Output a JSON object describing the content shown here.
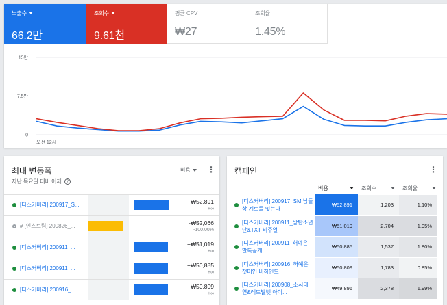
{
  "metrics": [
    {
      "label": "노출수",
      "value": "66.2만",
      "style": "blue",
      "dropdown": true
    },
    {
      "label": "조회수",
      "value": "9.61천",
      "style": "red",
      "dropdown": true
    },
    {
      "label": "평균 CPV",
      "value": "₩27",
      "style": "plain",
      "dropdown": false
    },
    {
      "label": "조회율",
      "value": "1.45%",
      "style": "plain",
      "dropdown": false
    }
  ],
  "chart_data": {
    "type": "line",
    "y_ticks": [
      "15만",
      "7.5만",
      "0"
    ],
    "ylim": [
      0,
      15
    ],
    "x_tick": "오전 12시",
    "grid": true,
    "series": [
      {
        "color": "#1a73e8",
        "values": [
          2.6,
          1.7,
          1.3,
          1.0,
          0.7,
          0.7,
          0.9,
          1.9,
          2.6,
          2.5,
          2.3,
          2.7,
          3.1,
          5.5,
          3.0,
          1.8,
          1.7,
          1.7,
          2.4,
          2.9,
          3.1
        ]
      },
      {
        "color": "#d93025",
        "values": [
          3.1,
          2.4,
          1.8,
          1.2,
          0.8,
          0.8,
          1.2,
          2.3,
          3.1,
          3.2,
          3.4,
          3.5,
          3.6,
          8.1,
          4.8,
          2.8,
          2.8,
          2.7,
          3.6,
          4.1,
          4.0
        ]
      }
    ]
  },
  "movers": {
    "title": "최대 변동폭",
    "subtitle": "지난 목요일 대비 어제",
    "sort_label": "비용",
    "rows": [
      {
        "name": "[디스커버리] 200917_S...",
        "amount": "+₩52,891",
        "pct": "+∞",
        "bar_value": 52891,
        "status_color": "#1e8e3e",
        "paused": false
      },
      {
        "name": "# [인스트림] 200826_...",
        "amount": "-₩52,066",
        "pct": "-100.00%",
        "bar_value": -52066,
        "status_color": "#9aa0a6",
        "paused": true
      },
      {
        "name": "[디스커버리] 200911_...",
        "amount": "+₩51,019",
        "pct": "+∞",
        "bar_value": 51019,
        "status_color": "#1e8e3e",
        "paused": false
      },
      {
        "name": "[디스커버리] 200911_...",
        "amount": "+₩50,885",
        "pct": "+∞",
        "bar_value": 50885,
        "status_color": "#1e8e3e",
        "paused": false
      },
      {
        "name": "[디스커버리] 200916_...",
        "amount": "+₩50,809",
        "pct": "+∞",
        "bar_value": 50809,
        "status_color": "#1e8e3e",
        "paused": false
      }
    ]
  },
  "campaigns": {
    "title": "캠페인",
    "columns": [
      "비용",
      "조회수",
      "조회율"
    ],
    "rows": [
      {
        "name": "[디스커버리] 200917_SM 남들상 계토를 잇는다",
        "cost": "₩52,891",
        "views": "1,203",
        "rate": "1.10%",
        "cost_bg": "#1a73e8",
        "cost_fg": "#ffffff",
        "views_bg": "#f1f3f4",
        "rate_bg": "#e8eaed"
      },
      {
        "name": "[디스커버리] 200911_방탄소년단&TXT 비주얼",
        "cost": "₩51,019",
        "views": "2,704",
        "rate": "1.95%",
        "cost_bg": "#a8c7fa",
        "cost_fg": "#202124",
        "views_bg": "#dadce0",
        "rate_bg": "#dadce0"
      },
      {
        "name": "[디스커버리] 200911_허예은_발톡공개",
        "cost": "₩50,885",
        "views": "1,537",
        "rate": "1.80%",
        "cost_bg": "#d2e3fc",
        "cost_fg": "#202124",
        "views_bg": "#e8eaed",
        "rate_bg": "#e3e5e8"
      },
      {
        "name": "[디스커버리] 200916_허예은_챗미인 비하인드",
        "cost": "₩50,809",
        "views": "1,783",
        "rate": "0.85%",
        "cost_bg": "#e8f0fe",
        "cost_fg": "#202124",
        "views_bg": "#e8eaed",
        "rate_bg": "#f1f3f4"
      },
      {
        "name": "[디스커버리] 200908_소시태연&레드벨벳 아이...",
        "cost": "₩49,896",
        "views": "2,378",
        "rate": "1.99%",
        "cost_bg": "#f5f8fd",
        "cost_fg": "#202124",
        "views_bg": "#dadce0",
        "rate_bg": "#d6d8db"
      }
    ]
  }
}
